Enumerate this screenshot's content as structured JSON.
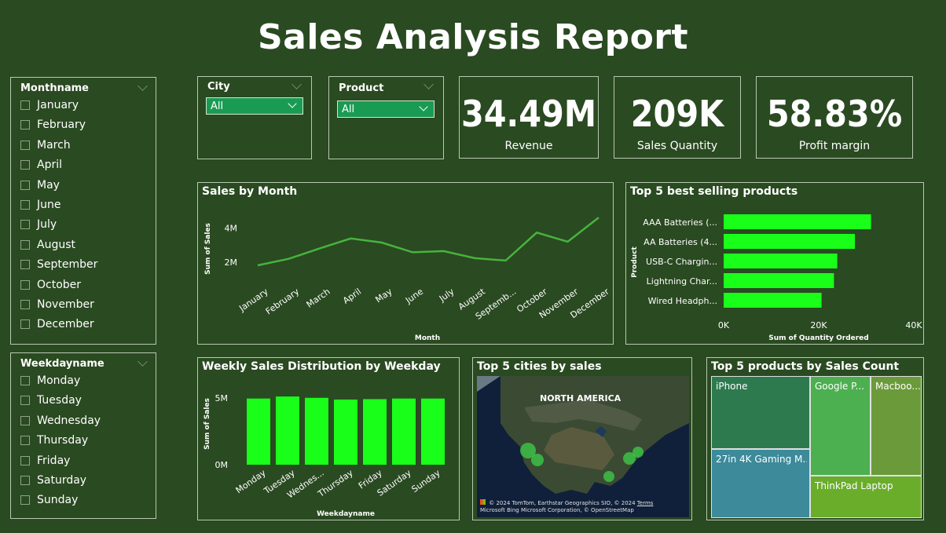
{
  "report": {
    "title": "Sales Analysis Report"
  },
  "slicers": {
    "month": {
      "title": "Monthname",
      "items": [
        "January",
        "February",
        "March",
        "April",
        "May",
        "June",
        "July",
        "August",
        "September",
        "October",
        "November",
        "December"
      ]
    },
    "weekday": {
      "title": "Weekdayname",
      "items": [
        "Monday",
        "Tuesday",
        "Wednesday",
        "Thursday",
        "Friday",
        "Saturday",
        "Sunday"
      ]
    },
    "city": {
      "title": "City",
      "value": "All"
    },
    "product": {
      "title": "Product",
      "value": "All"
    }
  },
  "kpis": {
    "revenue": {
      "value": "34.49M",
      "label": "Revenue"
    },
    "quantity": {
      "value": "209K",
      "label": "Sales Quantity"
    },
    "margin": {
      "value": "58.83%",
      "label": "Profit margin"
    }
  },
  "colors": {
    "background": "#2a4a21",
    "accent_green": "#1aff1a",
    "line_green": "#47b33d",
    "dropdown": "#1a9b54"
  },
  "charts": {
    "sales_by_month": {
      "title": "Sales by Month"
    },
    "top5_products": {
      "title": "Top 5 best selling products"
    },
    "weekly": {
      "title": "Weekly Sales Distribution by Weekday"
    },
    "cities_map": {
      "title": "Top 5 cities by sales",
      "region_label": "NORTH AMERICA",
      "attribution_1": "© 2024 TomTom, Earthstar Geographics SIO, © 2024",
      "attribution_2": "Microsoft Corporation, © OpenStreetMap",
      "terms": "Terms",
      "bing": "Microsoft Bing"
    },
    "treemap": {
      "title": "Top 5 products by Sales Count"
    }
  },
  "chart_data": [
    {
      "id": "sales_by_month",
      "type": "line",
      "title": "Sales by Month",
      "xlabel": "Month",
      "ylabel": "Sum of Sales",
      "categories": [
        "January",
        "February",
        "March",
        "April",
        "May",
        "June",
        "July",
        "August",
        "September",
        "October",
        "November",
        "December"
      ],
      "tick_labels": [
        "January",
        "February",
        "March",
        "April",
        "May",
        "June",
        "July",
        "August",
        "Septemb...",
        "October",
        "November",
        "December"
      ],
      "values": [
        1.82,
        2.2,
        2.81,
        3.39,
        3.15,
        2.58,
        2.65,
        2.24,
        2.1,
        3.73,
        3.2,
        4.61
      ],
      "yticks": [
        "2M",
        "4M"
      ],
      "ytick_values": [
        2,
        4
      ],
      "ylim": [
        1.5,
        4.8
      ],
      "unit": "M",
      "grid": false
    },
    {
      "id": "top5_products",
      "type": "bar",
      "orientation": "horizontal",
      "title": "Top 5 best selling products",
      "xlabel": "Sum of Quantity Ordered",
      "ylabel": "Product",
      "categories": [
        "AAA Batteries (...",
        "AA Batteries (4...",
        "USB-C Chargin...",
        "Lightning Char...",
        "Wired Headph..."
      ],
      "values": [
        31000,
        27600,
        23900,
        23200,
        20600
      ],
      "xticks": [
        "0K",
        "20K",
        "40K"
      ],
      "xtick_values": [
        0,
        20000,
        40000
      ],
      "xlim": [
        0,
        40000
      ]
    },
    {
      "id": "weekly",
      "type": "bar",
      "title": "Weekly Sales Distribution by Weekday",
      "xlabel": "Weekdayname",
      "ylabel": "Sum of Sales",
      "categories": [
        "Monday",
        "Tuesday",
        "Wednesday",
        "Thursday",
        "Friday",
        "Saturday",
        "Sunday"
      ],
      "tick_labels": [
        "Monday",
        "Tuesday",
        "Wednes...",
        "Thursday",
        "Friday",
        "Saturday",
        "Sunday"
      ],
      "values": [
        4.95,
        5.1,
        5.0,
        4.87,
        4.9,
        4.95,
        4.95
      ],
      "yticks": [
        "0M",
        "5M"
      ],
      "ytick_values": [
        0,
        5
      ],
      "ylim": [
        0,
        5.4
      ],
      "unit": "M"
    },
    {
      "id": "treemap",
      "type": "treemap",
      "title": "Top 5 products by Sales Count",
      "categories": [
        "iPhone",
        "27in 4K Gaming M...",
        "Google P...",
        "ThinkPad Laptop",
        "Macboo..."
      ],
      "colors": [
        "#2d7a4f",
        "#3c8a9a",
        "#4caf50",
        "#6aad2b",
        "#6b9a3b"
      ]
    }
  ]
}
